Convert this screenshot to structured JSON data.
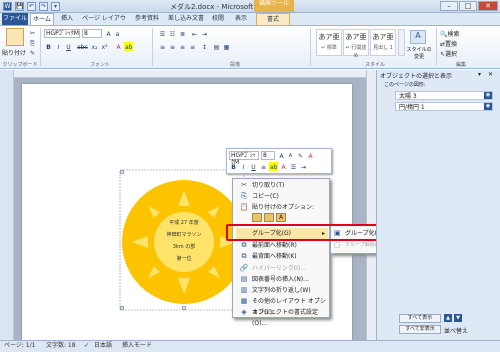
{
  "window": {
    "title": "メダル2.docx - Microsoft Word",
    "context_tools": "描画ツール",
    "min": "–",
    "max": "□",
    "close": "✕"
  },
  "qat": [
    "W",
    "💾",
    "↶",
    "↷",
    "▾"
  ],
  "tabs": {
    "file": "ファイル",
    "home": "ホーム",
    "insert": "挿入",
    "layout": "ページ レイアウト",
    "references": "参考資料",
    "mailings": "差し込み文書",
    "review": "校閲",
    "view": "表示",
    "format": "書式"
  },
  "ribbon": {
    "paste": "貼り付け",
    "font_name": "HGPｺﾞｼｯｸM",
    "font_size": "8",
    "bold": "B",
    "italic": "I",
    "underline": "U",
    "strike": "abc",
    "sub": "x₂",
    "sup": "x²",
    "font_color": "A",
    "highlight": "ab",
    "styles": [
      {
        "sample": "あア亜",
        "name": "↵ 標準"
      },
      {
        "sample": "あア亜",
        "name": "↵ 行間詰め"
      },
      {
        "sample": "あア亜",
        "name": "見出し 1"
      }
    ],
    "change_styles": "スタイルの変更",
    "find": "検索",
    "replace": "置換",
    "select": "選択",
    "groups": {
      "clipboard": "クリップボード",
      "font": "フォント",
      "paragraph": "段落",
      "styles": "スタイル",
      "editing": "編集"
    }
  },
  "pane": {
    "title": "オブジェクトの選択と表示",
    "subtitle": "このページの図形:",
    "items": [
      "太陽 3",
      "円/楕円 1"
    ],
    "show_all": "すべて表示",
    "hide_all": "すべて非表示",
    "reorder": "並べ替え"
  },
  "sun_text": [
    "平成 27 年度",
    "神田町マラソン",
    "3km の部",
    "第一位"
  ],
  "minitool": {
    "font": "HGPｺﾞｼｯｸM",
    "size": "8",
    "grow": "A",
    "shrink": "A",
    "bold": "B",
    "italic": "I",
    "underline": "U"
  },
  "context_menu": {
    "cut": "切り取り(T)",
    "copy": "コピー(C)",
    "paste_options": "貼り付けのオプション:",
    "group": "グループ化(G)",
    "front": "最前面へ移動(R)",
    "back": "最背面へ移動(K)",
    "hyperlink": "ハイパーリンク(I)...",
    "caption": "図表番号の挿入(N)...",
    "wrap": "文字列の折り返し(W)",
    "layout_options": "その他のレイアウト オプション(L)...",
    "format": "オブジェクトの書式設定(O)..."
  },
  "submenu": {
    "group": "グループ化(G)",
    "ungroup": "グループ解除(U)"
  },
  "status": {
    "page": "ページ: 1/1",
    "words": "文字数: 18",
    "lang": "日本語",
    "mode": "挿入モード"
  }
}
